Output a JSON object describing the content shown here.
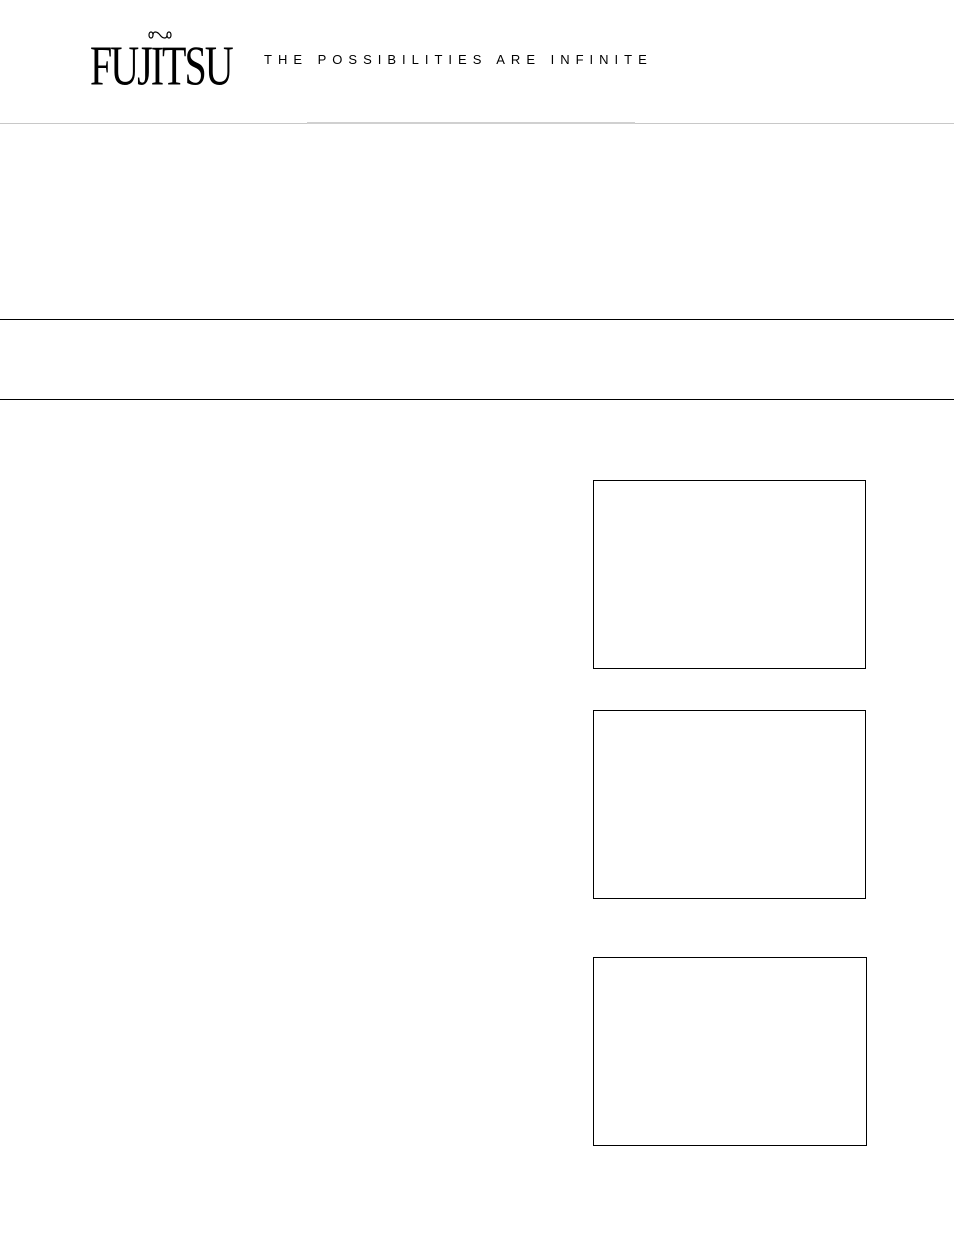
{
  "header": {
    "logo_text": "FUJITSU",
    "tagline": "THE POSSIBILITIES ARE INFINITE"
  }
}
